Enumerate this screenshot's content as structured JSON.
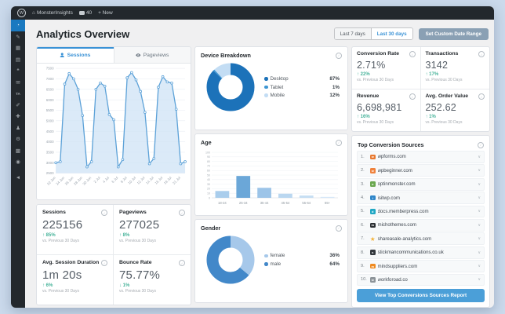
{
  "colors": {
    "accent_blue": "#3a92d6",
    "positive_green": "#47b39a",
    "admin_dark": "#23282d",
    "selected_blue": "#1a79c0"
  },
  "admin_bar": {
    "site_name": "MonsterInsights",
    "comments_count": "40",
    "new_label": "+ New"
  },
  "sidebar": {
    "items": [
      {
        "id": "dashboard",
        "glyph": "◔",
        "active": true
      },
      {
        "id": "posts",
        "glyph": "✎"
      },
      {
        "id": "media",
        "glyph": "▦"
      },
      {
        "id": "pages",
        "glyph": "▤"
      },
      {
        "id": "comments",
        "glyph": "❝"
      },
      {
        "id": "feedback",
        "glyph": "✉"
      },
      {
        "id": "analytics-ta",
        "glyph": "TA"
      },
      {
        "id": "appearance",
        "glyph": "✐"
      },
      {
        "id": "plugins",
        "glyph": "✚"
      },
      {
        "id": "users",
        "glyph": "♟"
      },
      {
        "id": "tools",
        "glyph": "⚙"
      },
      {
        "id": "settings",
        "glyph": "▩"
      },
      {
        "id": "monsterinsights",
        "glyph": "◉"
      },
      {
        "id": "collapse",
        "glyph": "◄"
      }
    ]
  },
  "header": {
    "title": "Analytics Overview",
    "range_tabs": [
      {
        "label": "Last 7 days",
        "selected": false
      },
      {
        "label": "Last 30 days",
        "selected": true
      }
    ],
    "custom_button": "Set Custom Date Range"
  },
  "chart_tabs": [
    {
      "label": "Sessions",
      "selected": true
    },
    {
      "label": "Pageviews",
      "selected": false
    }
  ],
  "stats_left": [
    {
      "label": "Sessions",
      "value": "225156",
      "change": "85%",
      "direction": "up",
      "compare": "vs. Previous 30 Days"
    },
    {
      "label": "Pageviews",
      "value": "277025",
      "change": "8%",
      "direction": "up",
      "compare": "vs. Previous 30 Days"
    },
    {
      "label": "Avg. Session Duration",
      "value": "1m 20s",
      "change": "6%",
      "direction": "up",
      "compare": "vs. Previous 30 Days"
    },
    {
      "label": "Bounce Rate",
      "value": "75.77%",
      "change": "1%",
      "direction": "down",
      "compare": "vs. Previous 30 Days"
    }
  ],
  "stats_right": [
    {
      "label": "Conversion Rate",
      "value": "2.71%",
      "change": "22%",
      "direction": "up",
      "compare": "vs. Previous 30 Days"
    },
    {
      "label": "Transactions",
      "value": "3142",
      "change": "17%",
      "direction": "up",
      "compare": "vs. Previous 30 Days"
    },
    {
      "label": "Revenue",
      "value": "6,698,981",
      "change": "16%",
      "direction": "up",
      "compare": "vs. Previous 30 Days"
    },
    {
      "label": "Avg. Order Value",
      "value": "252.62",
      "change": "1%",
      "direction": "up",
      "compare": "vs. Previous 30 Days"
    }
  ],
  "panels": {
    "device": {
      "title": "Device Breakdown"
    },
    "age": {
      "title": "Age"
    },
    "gender": {
      "title": "Gender"
    }
  },
  "sources": {
    "title": "Top Conversion Sources",
    "items": [
      {
        "rank": "1.",
        "domain": "wpforms.com",
        "color": "#e8792f",
        "star": false
      },
      {
        "rank": "2.",
        "domain": "wpbeginner.com",
        "color": "#f0823c",
        "star": false
      },
      {
        "rank": "3.",
        "domain": "optinmonster.com",
        "color": "#6aa84f",
        "star": false
      },
      {
        "rank": "4.",
        "domain": "isitwp.com",
        "color": "#2f86c9",
        "star": false
      },
      {
        "rank": "5.",
        "domain": "docs.memberpress.com",
        "color": "#1fa7c4",
        "star": false
      },
      {
        "rank": "6.",
        "domain": "michothemes.com",
        "color": "#2b2f33",
        "star": false
      },
      {
        "rank": "7.",
        "domain": "shareasale-analytics.com",
        "color": "#f4b43c",
        "star": true
      },
      {
        "rank": "8.",
        "domain": "stickmancommunications.co.uk",
        "color": "#33383d",
        "star": false
      },
      {
        "rank": "9.",
        "domain": "mindsuppliers.com",
        "color": "#ef8a1f",
        "star": false
      },
      {
        "rank": "10.",
        "domain": "workforoad.co",
        "color": "#8d9499",
        "star": false
      }
    ],
    "button": "View Top Conversions Sources Report"
  },
  "chart_data": [
    {
      "id": "sessions-line",
      "type": "area",
      "title": "Sessions (Last 30 days)",
      "x_labels": [
        "22 Jun",
        "24 Jun",
        "26 Jun",
        "28 Jun",
        "30 Jun",
        "2 Jul",
        "4 Jul",
        "6 Jul",
        "8 Jul",
        "10 Jul",
        "12 Jul",
        "14 Jul",
        "16 Jul",
        "18 Jul",
        "21 Jul"
      ],
      "values": [
        3000,
        3050,
        6750,
        7250,
        7000,
        6500,
        5250,
        2800,
        3050,
        6500,
        6800,
        6650,
        5300,
        5050,
        2800,
        3150,
        7050,
        7300,
        6950,
        6400,
        5400,
        2950,
        3200,
        6600,
        7100,
        6850,
        6800,
        5550,
        2950,
        3050
      ],
      "ylim": [
        2500,
        7500
      ],
      "y_ticks": [
        2500,
        3000,
        3500,
        4000,
        4500,
        5000,
        5500,
        6000,
        6500,
        7000,
        7500
      ],
      "line_color": "#5da2d8",
      "fill_color": "#cfe3f5",
      "grid": true,
      "legend_position": "none"
    },
    {
      "id": "device-donut",
      "type": "pie",
      "title": "Device Breakdown",
      "labels": [
        "Desktop",
        "Tablet",
        "Mobile"
      ],
      "values": [
        87,
        1,
        12
      ],
      "colors": [
        "#1c72b9",
        "#3f97d3",
        "#c3ddf4"
      ],
      "legend_position": "right"
    },
    {
      "id": "age-bars",
      "type": "bar",
      "title": "Age",
      "categories": [
        "18-24",
        "25-34",
        "35-44",
        "45-54",
        "55-64",
        "65+"
      ],
      "values": [
        15,
        48,
        22,
        9,
        5,
        2
      ],
      "ylim": [
        0,
        100
      ],
      "bar_colors": [
        "#a9cdec",
        "#6ba7d8",
        "#9cc4e8",
        "#bad7f0",
        "#c6def3",
        "#d5e7f8"
      ],
      "grid": true,
      "legend_position": "none"
    },
    {
      "id": "gender-donut",
      "type": "pie",
      "title": "Gender",
      "labels": [
        "female",
        "male"
      ],
      "values": [
        36,
        64
      ],
      "colors": [
        "#a6c8ea",
        "#4288c9"
      ],
      "legend_position": "right"
    }
  ]
}
